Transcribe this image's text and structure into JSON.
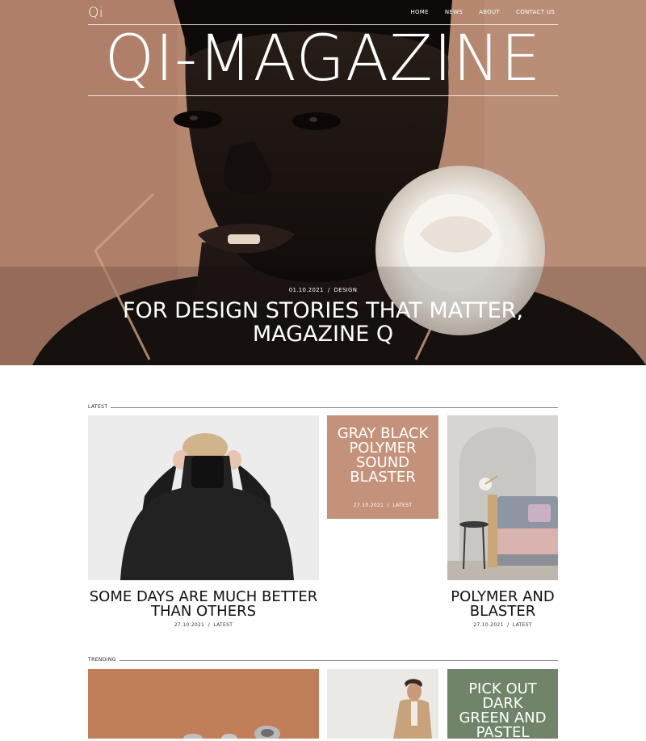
{
  "nav": {
    "logo": "Qi",
    "items": [
      "HOME",
      "NEWS",
      "ABOUT",
      "CONTACT US"
    ]
  },
  "hero": {
    "masthead": "QI-MAGAZINE",
    "meta": "01.10.2021  /  DESIGN",
    "title_line1": "FOR DESIGN STORIES THAT MATTER,",
    "title_line2": "MAGAZINE Q"
  },
  "latest": {
    "label": "LATEST",
    "cards": [
      {
        "title_line1": "SOME DAYS ARE MUCH BETTER",
        "title_line2": "THAN OTHERS",
        "meta": "27.10.2021  /  LATEST"
      },
      {
        "title_lines": [
          "GRAY BLACK",
          "POLYMER",
          "SOUND",
          "BLASTER"
        ],
        "meta": "27.10.2021  /  LATEST"
      },
      {
        "title_line1": "POLYMER AND",
        "title_line2": "BLASTER",
        "meta": "27.10.2021  /  LATEST"
      }
    ]
  },
  "trending": {
    "label": "TRENDING",
    "tile": {
      "title_lines": [
        "PICK OUT",
        "DARK",
        "GREEN AND",
        "PASTEL"
      ]
    }
  },
  "colors": {
    "hero_bg": "#b38673",
    "tile_terracotta": "#c4927b",
    "tile_green": "#6f8468"
  }
}
